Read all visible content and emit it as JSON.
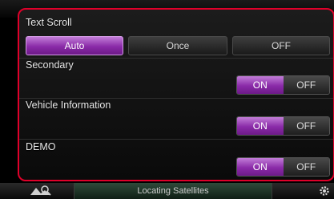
{
  "text_scroll": {
    "label": "Text Scroll",
    "options": [
      {
        "label": "Auto",
        "selected": true
      },
      {
        "label": "Once",
        "selected": false
      },
      {
        "label": "OFF",
        "selected": false
      }
    ]
  },
  "secondary": {
    "label": "Secondary",
    "on_label": "ON",
    "off_label": "OFF",
    "value": "ON"
  },
  "vehicle_information": {
    "label": "Vehicle Information",
    "on_label": "ON",
    "off_label": "OFF",
    "value": "ON"
  },
  "demo": {
    "label": "DEMO",
    "on_label": "ON",
    "off_label": "OFF",
    "value": "ON"
  },
  "status_bar": {
    "text": "Locating Satellites"
  },
  "icons": {
    "left": "map-search-icon",
    "right": "gear-icon"
  },
  "colors": {
    "accent": "#9b3cc0",
    "frame": "#e0002a"
  }
}
